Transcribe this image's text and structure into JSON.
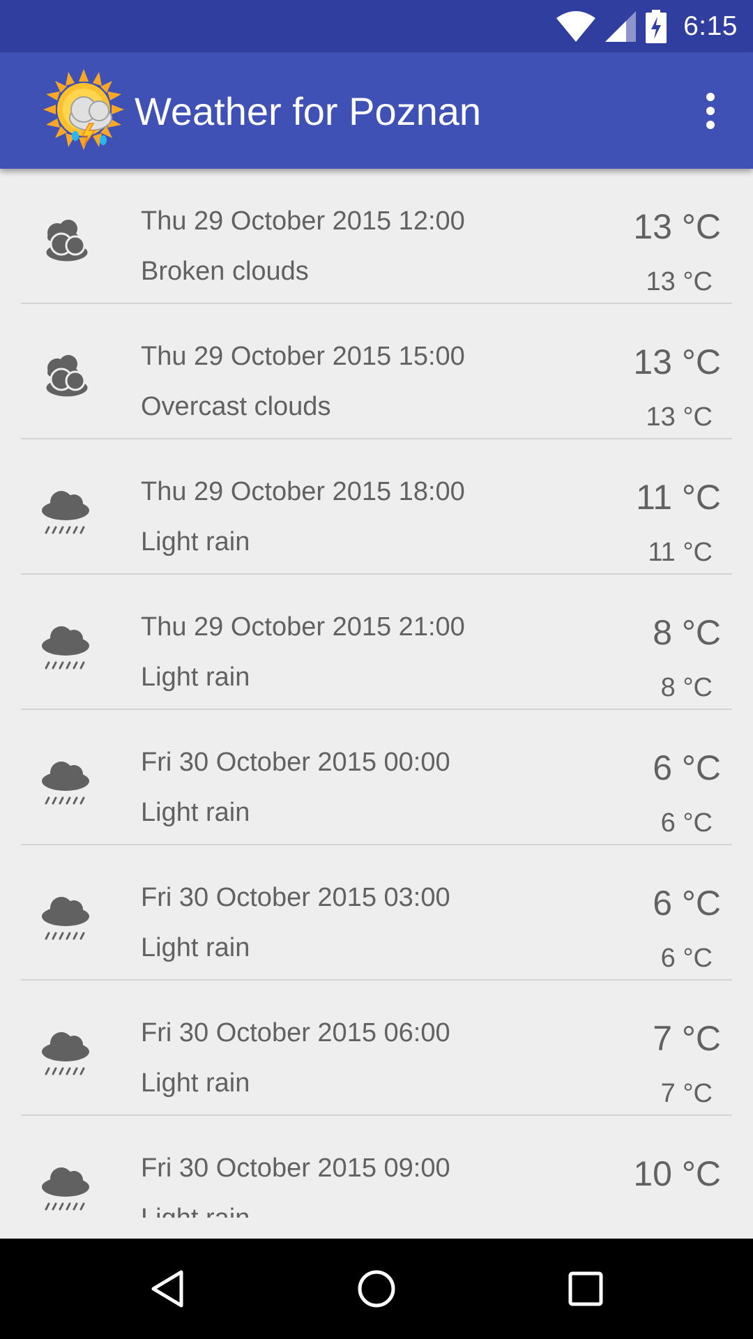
{
  "status_bar": {
    "time": "6:15",
    "icons": [
      "wifi-icon",
      "cell-signal-icon",
      "battery-charging-icon"
    ]
  },
  "app_bar": {
    "title": "Weather for Poznan",
    "logo_icon": "sun-cloud-storm-icon",
    "menu_icon": "overflow-menu-icon"
  },
  "forecast": [
    {
      "date": "Thu 29 October 2015 12:00",
      "description": "Broken clouds",
      "temp": "13 °C",
      "temp_small": "13 °C",
      "icon": "broken-clouds-icon"
    },
    {
      "date": "Thu 29 October 2015 15:00",
      "description": "Overcast clouds",
      "temp": "13 °C",
      "temp_small": "13 °C",
      "icon": "overcast-clouds-icon"
    },
    {
      "date": "Thu 29 October 2015 18:00",
      "description": "Light rain",
      "temp": "11 °C",
      "temp_small": "11 °C",
      "icon": "light-rain-icon"
    },
    {
      "date": "Thu 29 October 2015 21:00",
      "description": "Light rain",
      "temp": "8 °C",
      "temp_small": "8 °C",
      "icon": "light-rain-icon"
    },
    {
      "date": "Fri 30 October 2015 00:00",
      "description": "Light rain",
      "temp": "6 °C",
      "temp_small": "6 °C",
      "icon": "light-rain-icon"
    },
    {
      "date": "Fri 30 October 2015 03:00",
      "description": "Light rain",
      "temp": "6 °C",
      "temp_small": "6 °C",
      "icon": "light-rain-icon"
    },
    {
      "date": "Fri 30 October 2015 06:00",
      "description": "Light rain",
      "temp": "7 °C",
      "temp_small": "7 °C",
      "icon": "light-rain-icon"
    },
    {
      "date": "Fri 30 October 2015 09:00",
      "description": "Light rain",
      "temp": "10 °C",
      "temp_small": "",
      "icon": "light-rain-icon"
    }
  ],
  "nav_bar": {
    "buttons": [
      "back-icon",
      "home-icon",
      "recents-icon"
    ]
  },
  "colors": {
    "status_bar": "#303f9f",
    "app_bar": "#3f51b5",
    "background": "#eeeeee",
    "text": "#616161",
    "icon": "#616161"
  }
}
